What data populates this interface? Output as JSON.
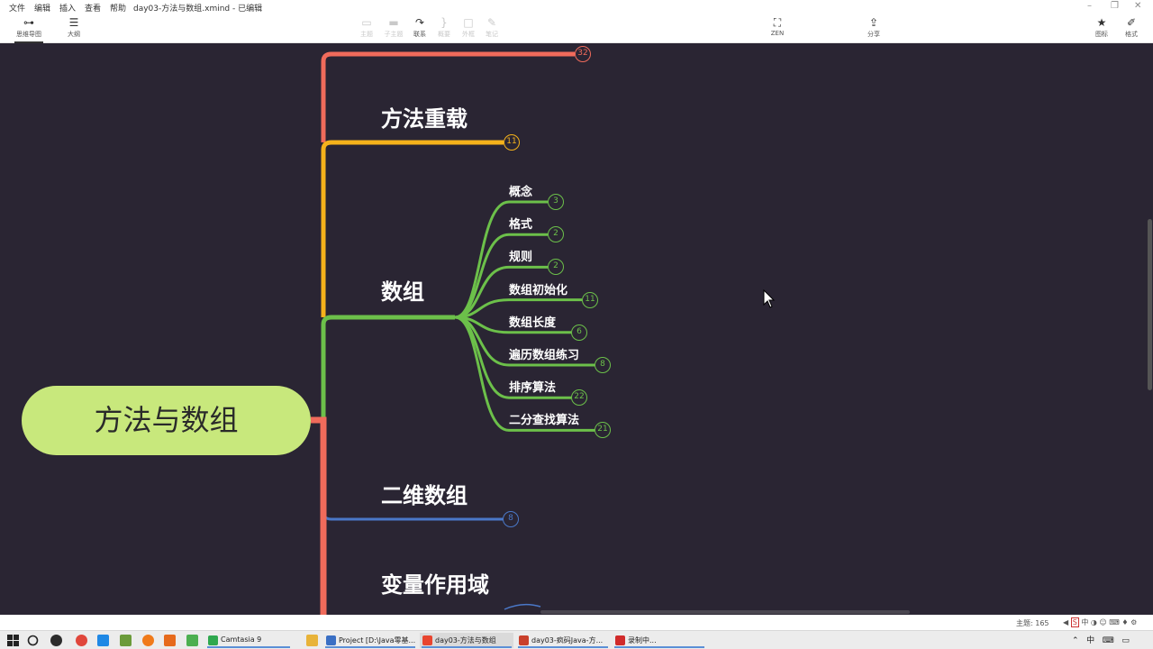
{
  "menu": {
    "items": [
      "文件",
      "编辑",
      "插入",
      "查看",
      "帮助"
    ],
    "document_title": "day03-方法与数组.xmind - 已编辑"
  },
  "toolbar": {
    "view_tabs": [
      {
        "label": "思维导图",
        "icon": "mindmap-icon"
      },
      {
        "label": "大纲",
        "icon": "outline-icon"
      }
    ],
    "insert_tools": [
      {
        "label": "主题",
        "icon": "topic-icon",
        "enabled": false
      },
      {
        "label": "子主题",
        "icon": "subtopic-icon",
        "enabled": false
      },
      {
        "label": "联系",
        "icon": "relationship-icon",
        "enabled": true
      },
      {
        "label": "概要",
        "icon": "summary-icon",
        "enabled": false
      },
      {
        "label": "外框",
        "icon": "boundary-icon",
        "enabled": false
      },
      {
        "label": "笔记",
        "icon": "note-icon",
        "enabled": false
      }
    ],
    "zen_label": "ZEN",
    "share_label": "分享",
    "right_panels": [
      {
        "label": "图标",
        "icon": "star-icon"
      },
      {
        "label": "格式",
        "icon": "brush-icon"
      }
    ]
  },
  "mindmap": {
    "central_topic": "方法与数组",
    "branches": [
      {
        "label": "",
        "count": "32",
        "color": "#f06b5b"
      },
      {
        "label": "方法重载",
        "count": "11",
        "color": "#f5b21b"
      },
      {
        "label": "数组",
        "count": "",
        "color": "#6cc04a",
        "subtopics": [
          {
            "label": "概念",
            "count": "3"
          },
          {
            "label": "格式",
            "count": "2"
          },
          {
            "label": "规则",
            "count": "2"
          },
          {
            "label": "数组初始化",
            "count": "11"
          },
          {
            "label": "数组长度",
            "count": "6"
          },
          {
            "label": "遍历数组练习",
            "count": "8"
          },
          {
            "label": "排序算法",
            "count": "22"
          },
          {
            "label": "二分查找算法",
            "count": "21"
          }
        ]
      },
      {
        "label": "二维数组",
        "count": "8",
        "color": "#4a78c8"
      },
      {
        "label": "变量作用域",
        "count": "",
        "color": "#f06b5b"
      }
    ]
  },
  "statusbar": {
    "theme_label": "主题: 165"
  },
  "taskbar": {
    "apps": [
      {
        "label": "Camtasia 9",
        "color": "#2fa84f"
      },
      {
        "label": "Project [D:\\Java零基...",
        "color": "#3a6fc4"
      },
      {
        "label": "day03-方法与数组",
        "color": "#e8452f"
      },
      {
        "label": "day03-疯码Java-方...",
        "color": "#c9402b"
      },
      {
        "label": "录制中...",
        "color": "#d12b2b"
      }
    ],
    "ime_label": "中"
  },
  "colors": {
    "canvas_bg": "#2a2533",
    "central_fill": "#c8e87c",
    "red_branch": "#f06b5b",
    "orange_branch": "#f5b21b",
    "green_branch": "#6cc04a",
    "blue_branch": "#4a78c8"
  }
}
